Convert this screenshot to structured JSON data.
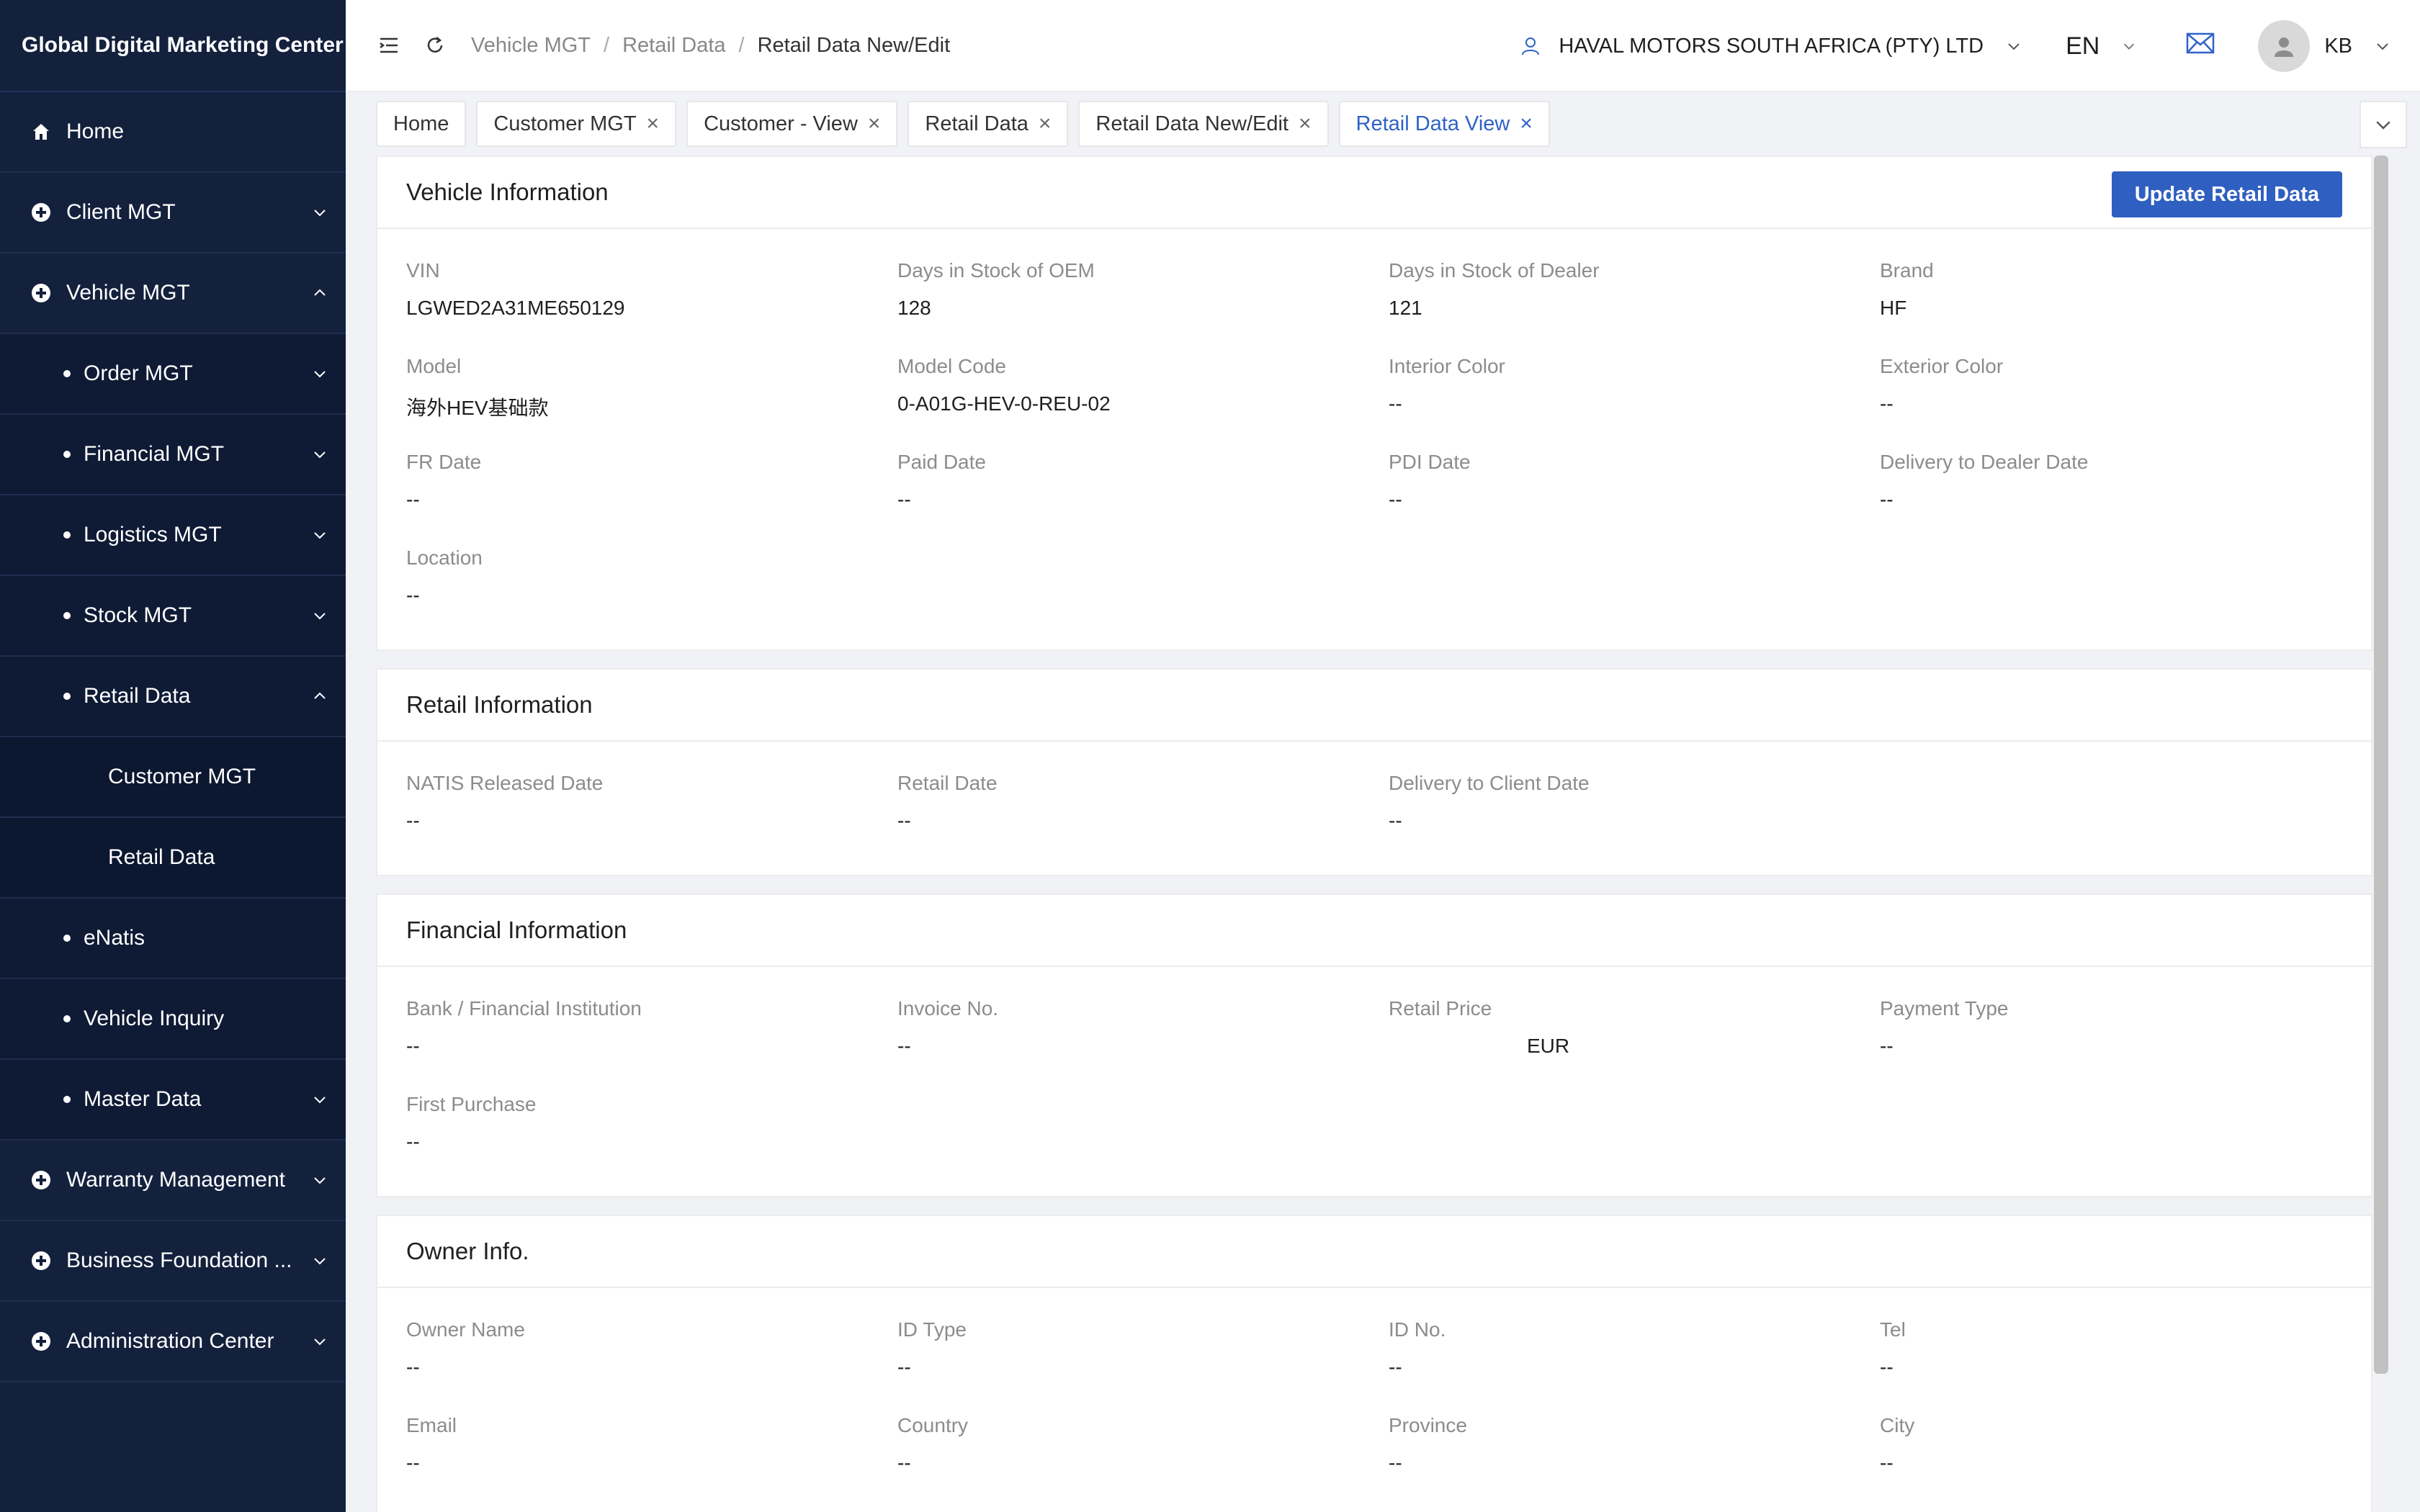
{
  "sidebar": {
    "brand": "Global Digital Marketing Center",
    "items": [
      {
        "label": "Home"
      },
      {
        "label": "Client MGT"
      },
      {
        "label": "Vehicle MGT"
      },
      {
        "label": "Order MGT"
      },
      {
        "label": "Financial MGT"
      },
      {
        "label": "Logistics MGT"
      },
      {
        "label": "Stock MGT"
      },
      {
        "label": "Retail Data"
      },
      {
        "label": "Customer MGT"
      },
      {
        "label": "Retail Data"
      },
      {
        "label": "eNatis"
      },
      {
        "label": "Vehicle Inquiry"
      },
      {
        "label": "Master Data"
      },
      {
        "label": "Warranty Management"
      },
      {
        "label": "Business Foundation ..."
      },
      {
        "label": "Administration Center"
      }
    ]
  },
  "header": {
    "breadcrumb": [
      "Vehicle MGT",
      "Retail Data",
      "Retail Data New/Edit"
    ],
    "breadcrumb_sep": "/",
    "company": "HAVAL MOTORS SOUTH AFRICA (PTY) LTD",
    "language": "EN",
    "user": "KB"
  },
  "tabs": [
    {
      "label": "Home",
      "closable": false
    },
    {
      "label": "Customer MGT",
      "closable": true
    },
    {
      "label": "Customer - View",
      "closable": true
    },
    {
      "label": "Retail Data",
      "closable": true
    },
    {
      "label": "Retail Data New/Edit",
      "closable": true
    },
    {
      "label": "Retail Data View",
      "closable": true,
      "active": true
    }
  ],
  "tab_close_glyph": "×",
  "vehicle": {
    "title": "Vehicle Information",
    "update_button": "Update Retail Data",
    "fields": [
      {
        "label": "VIN",
        "value": "LGWED2A31ME650129"
      },
      {
        "label": "Days in Stock of OEM",
        "value": "128"
      },
      {
        "label": "Days in Stock of Dealer",
        "value": "121"
      },
      {
        "label": "Brand",
        "value": "HF"
      },
      {
        "label": "Model",
        "value": "海外HEV基础款"
      },
      {
        "label": "Model Code",
        "value": "0-A01G-HEV-0-REU-02"
      },
      {
        "label": "Interior Color",
        "value": "--"
      },
      {
        "label": "Exterior Color",
        "value": "--"
      },
      {
        "label": "FR Date",
        "value": "--"
      },
      {
        "label": "Paid Date",
        "value": "--"
      },
      {
        "label": "PDI Date",
        "value": "--"
      },
      {
        "label": "Delivery to Dealer Date",
        "value": "--"
      },
      {
        "label": "Location",
        "value": "--"
      }
    ]
  },
  "retail": {
    "title": "Retail Information",
    "fields": [
      {
        "label": "NATIS Released Date",
        "value": "--"
      },
      {
        "label": "Retail Date",
        "value": "--"
      },
      {
        "label": "Delivery to Client Date",
        "value": "--"
      }
    ]
  },
  "financial": {
    "title": "Financial Information",
    "fields": [
      {
        "label": "Bank / Financial Institution",
        "value": "--"
      },
      {
        "label": "Invoice No.",
        "value": "--"
      },
      {
        "label": "Retail Price",
        "value": "EUR"
      },
      {
        "label": "Payment Type",
        "value": "--"
      },
      {
        "label": "First Purchase",
        "value": "--"
      }
    ]
  },
  "owner": {
    "title": "Owner Info.",
    "fields": [
      {
        "label": "Owner Name",
        "value": "--"
      },
      {
        "label": "ID Type",
        "value": "--"
      },
      {
        "label": "ID No.",
        "value": "--"
      },
      {
        "label": "Tel",
        "value": "--"
      },
      {
        "label": "Email",
        "value": "--"
      },
      {
        "label": "Country",
        "value": "--"
      },
      {
        "label": "Province",
        "value": "--"
      },
      {
        "label": "City",
        "value": "--"
      }
    ]
  },
  "colors": {
    "sidebar_bg": "#14213d",
    "accent": "#2f5fc1",
    "active_tab": "#2f62c8"
  }
}
